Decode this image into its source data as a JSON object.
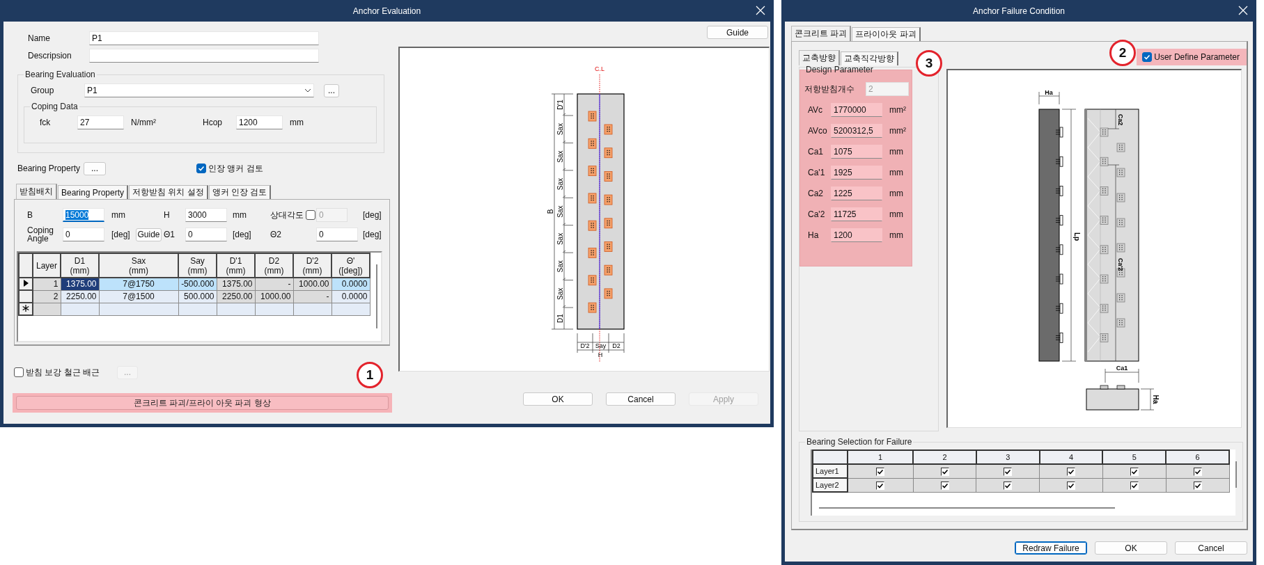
{
  "anchor_evaluation": {
    "title": "Anchor Evaluation",
    "name": {
      "label": "Name",
      "value": "P1"
    },
    "description": {
      "label": "Descripsion"
    },
    "bearing_evaluation": {
      "legend": "Bearing Evaluation",
      "group": {
        "label": "Group",
        "value": "P1",
        "browse": "..."
      },
      "coping_data": {
        "legend": "Coping Data",
        "fields": [
          {
            "label": "fck",
            "value": "27",
            "unit": "N/mm²"
          },
          {
            "label": "Hcop",
            "value": "1200",
            "unit": "mm"
          }
        ]
      }
    },
    "bearing_property": {
      "label": "Bearing Property",
      "browse": "...",
      "tension_check": {
        "label": "인장 앵커 검토",
        "checked": true
      }
    },
    "tabs": [
      {
        "label": "받침배치",
        "selected": true
      },
      {
        "label": "Bearing Property",
        "selected": false
      },
      {
        "label": "저항받침 위치 설정",
        "selected": false
      },
      {
        "label": "앵커 인장 검토",
        "selected": false
      }
    ],
    "layout_rows": [
      [
        {
          "kind": "field",
          "label": "B",
          "value": "15000",
          "unit": "mm",
          "focused": true
        },
        {
          "kind": "field",
          "label": "H",
          "value": "3000",
          "unit": "mm",
          "focused": false
        },
        {
          "kind": "check_field",
          "label": "상대각도",
          "checked": false,
          "value": "0",
          "unit": "[deg]",
          "focused": false
        }
      ],
      [
        {
          "kind": "field",
          "label": "Coping Angle",
          "value": "0",
          "unit": "[deg]",
          "focused": false
        },
        {
          "kind": "button",
          "label": "Guide"
        },
        {
          "kind": "field",
          "label": "Θ1",
          "value": "0",
          "unit": "[deg]",
          "focused": false
        },
        {
          "kind": "field",
          "label": "Θ2",
          "value": "0",
          "unit": "[deg]",
          "focused": false
        }
      ]
    ],
    "table": {
      "columns": [
        {
          "name": "Layer"
        },
        {
          "name": "D1",
          "unit": "(mm)"
        },
        {
          "name": "Sax",
          "unit": "(mm)"
        },
        {
          "name": "Say",
          "unit": "(mm)"
        },
        {
          "name": "D'1",
          "unit": "(mm)"
        },
        {
          "name": "D2",
          "unit": "(mm)"
        },
        {
          "name": "D'2",
          "unit": "(mm)"
        },
        {
          "name": "Θ'",
          "unit": "([deg])"
        }
      ],
      "rows": [
        {
          "selected": true,
          "cells": [
            {
              "text": "1",
              "readonly": true,
              "focused": false
            },
            {
              "text": "1375.00",
              "readonly": false,
              "focused": true
            },
            {
              "text": "7@1750",
              "readonly": false,
              "focused": false
            },
            {
              "text": "-500.000",
              "readonly": false,
              "focused": false
            },
            {
              "text": "1375.00",
              "readonly": true,
              "focused": false
            },
            {
              "text": "-",
              "readonly": true,
              "focused": false
            },
            {
              "text": "1000.00",
              "readonly": true,
              "focused": false
            },
            {
              "text": "0.0000",
              "readonly": false,
              "focused": false
            }
          ]
        },
        {
          "selected": false,
          "cells": [
            {
              "text": "2",
              "readonly": true,
              "focused": false
            },
            {
              "text": "2250.00",
              "readonly": false,
              "focused": false
            },
            {
              "text": "7@1500",
              "readonly": false,
              "focused": false
            },
            {
              "text": "500.000",
              "readonly": false,
              "focused": false
            },
            {
              "text": "2250.00",
              "readonly": true,
              "focused": false
            },
            {
              "text": "1000.00",
              "readonly": true,
              "focused": false
            },
            {
              "text": "-",
              "readonly": true,
              "focused": false
            },
            {
              "text": "0.0000",
              "readonly": false,
              "focused": false
            }
          ]
        }
      ]
    },
    "rebar": {
      "label": "받침 보강 철근 배근",
      "checked": false,
      "browse": "...",
      "browse_disabled": true
    },
    "failure_shape_button": "콘크리트 파괴/프라이 아웃 파괴 형상",
    "callout": "1",
    "guide_button": "Guide",
    "preview": {
      "labels": {
        "centerline": "C.L",
        "top_end": "D'1",
        "spacing": [
          "Sax",
          "Sax",
          "Sax",
          "Sax",
          "Sax",
          "Sax",
          "Sax"
        ],
        "bottom_end": "D1",
        "length": "B",
        "bottom_dims": [
          "D'2",
          "Say",
          "D2"
        ],
        "width": "H"
      }
    },
    "buttons": [
      {
        "label": "OK",
        "disabled": false
      },
      {
        "label": "Cancel",
        "disabled": false
      },
      {
        "label": "Apply",
        "disabled": true
      }
    ]
  },
  "anchor_failure_condition": {
    "title": "Anchor Failure Condition",
    "tabs": [
      {
        "label": "콘크리트 파괴",
        "selected": true
      },
      {
        "label": "프라이아웃 파괴",
        "selected": false
      }
    ],
    "sub_tabs": [
      {
        "label": "교축방향",
        "selected": true
      },
      {
        "label": "교축직각방향",
        "selected": false
      }
    ],
    "callouts": [
      "2",
      "3"
    ],
    "user_define": {
      "label": "User Define Parameter",
      "checked": true
    },
    "design_parameter": {
      "legend": "Design Parameter",
      "count": {
        "label": "저항받침개수",
        "value": "2"
      },
      "fields": [
        {
          "label": "AVc",
          "value": "1770000",
          "unit": "mm²"
        },
        {
          "label": "AVco",
          "value": "5200312,5",
          "unit": "mm²"
        },
        {
          "label": "Ca1",
          "value": "1075",
          "unit": "mm"
        },
        {
          "label": "Ca'1",
          "value": "1925",
          "unit": "mm"
        },
        {
          "label": "Ca2",
          "value": "1225",
          "unit": "mm"
        },
        {
          "label": "Ca'2",
          "value": "11725",
          "unit": "mm"
        },
        {
          "label": "Ha",
          "value": "1200",
          "unit": "mm"
        }
      ]
    },
    "preview": {
      "labels": {
        "top_width": "Ha",
        "length": "Lp",
        "edge_top": "Ca2",
        "edge_bottom": "Ca'2",
        "edge_side": "Ca1",
        "depth": "Ha"
      }
    },
    "bearing_selection": {
      "legend": "Bearing Selection for Failure",
      "columns": [
        "1",
        "2",
        "3",
        "4",
        "5",
        "6"
      ],
      "rows": [
        {
          "label": "Layer1",
          "checks": [
            true,
            true,
            true,
            true,
            true,
            true
          ]
        },
        {
          "label": "Layer2",
          "checks": [
            true,
            true,
            true,
            true,
            true,
            true
          ]
        }
      ]
    },
    "buttons": [
      {
        "label": "Redraw Failure",
        "focused": true
      },
      {
        "label": "OK",
        "focused": false
      },
      {
        "label": "Cancel",
        "focused": false
      }
    ]
  }
}
